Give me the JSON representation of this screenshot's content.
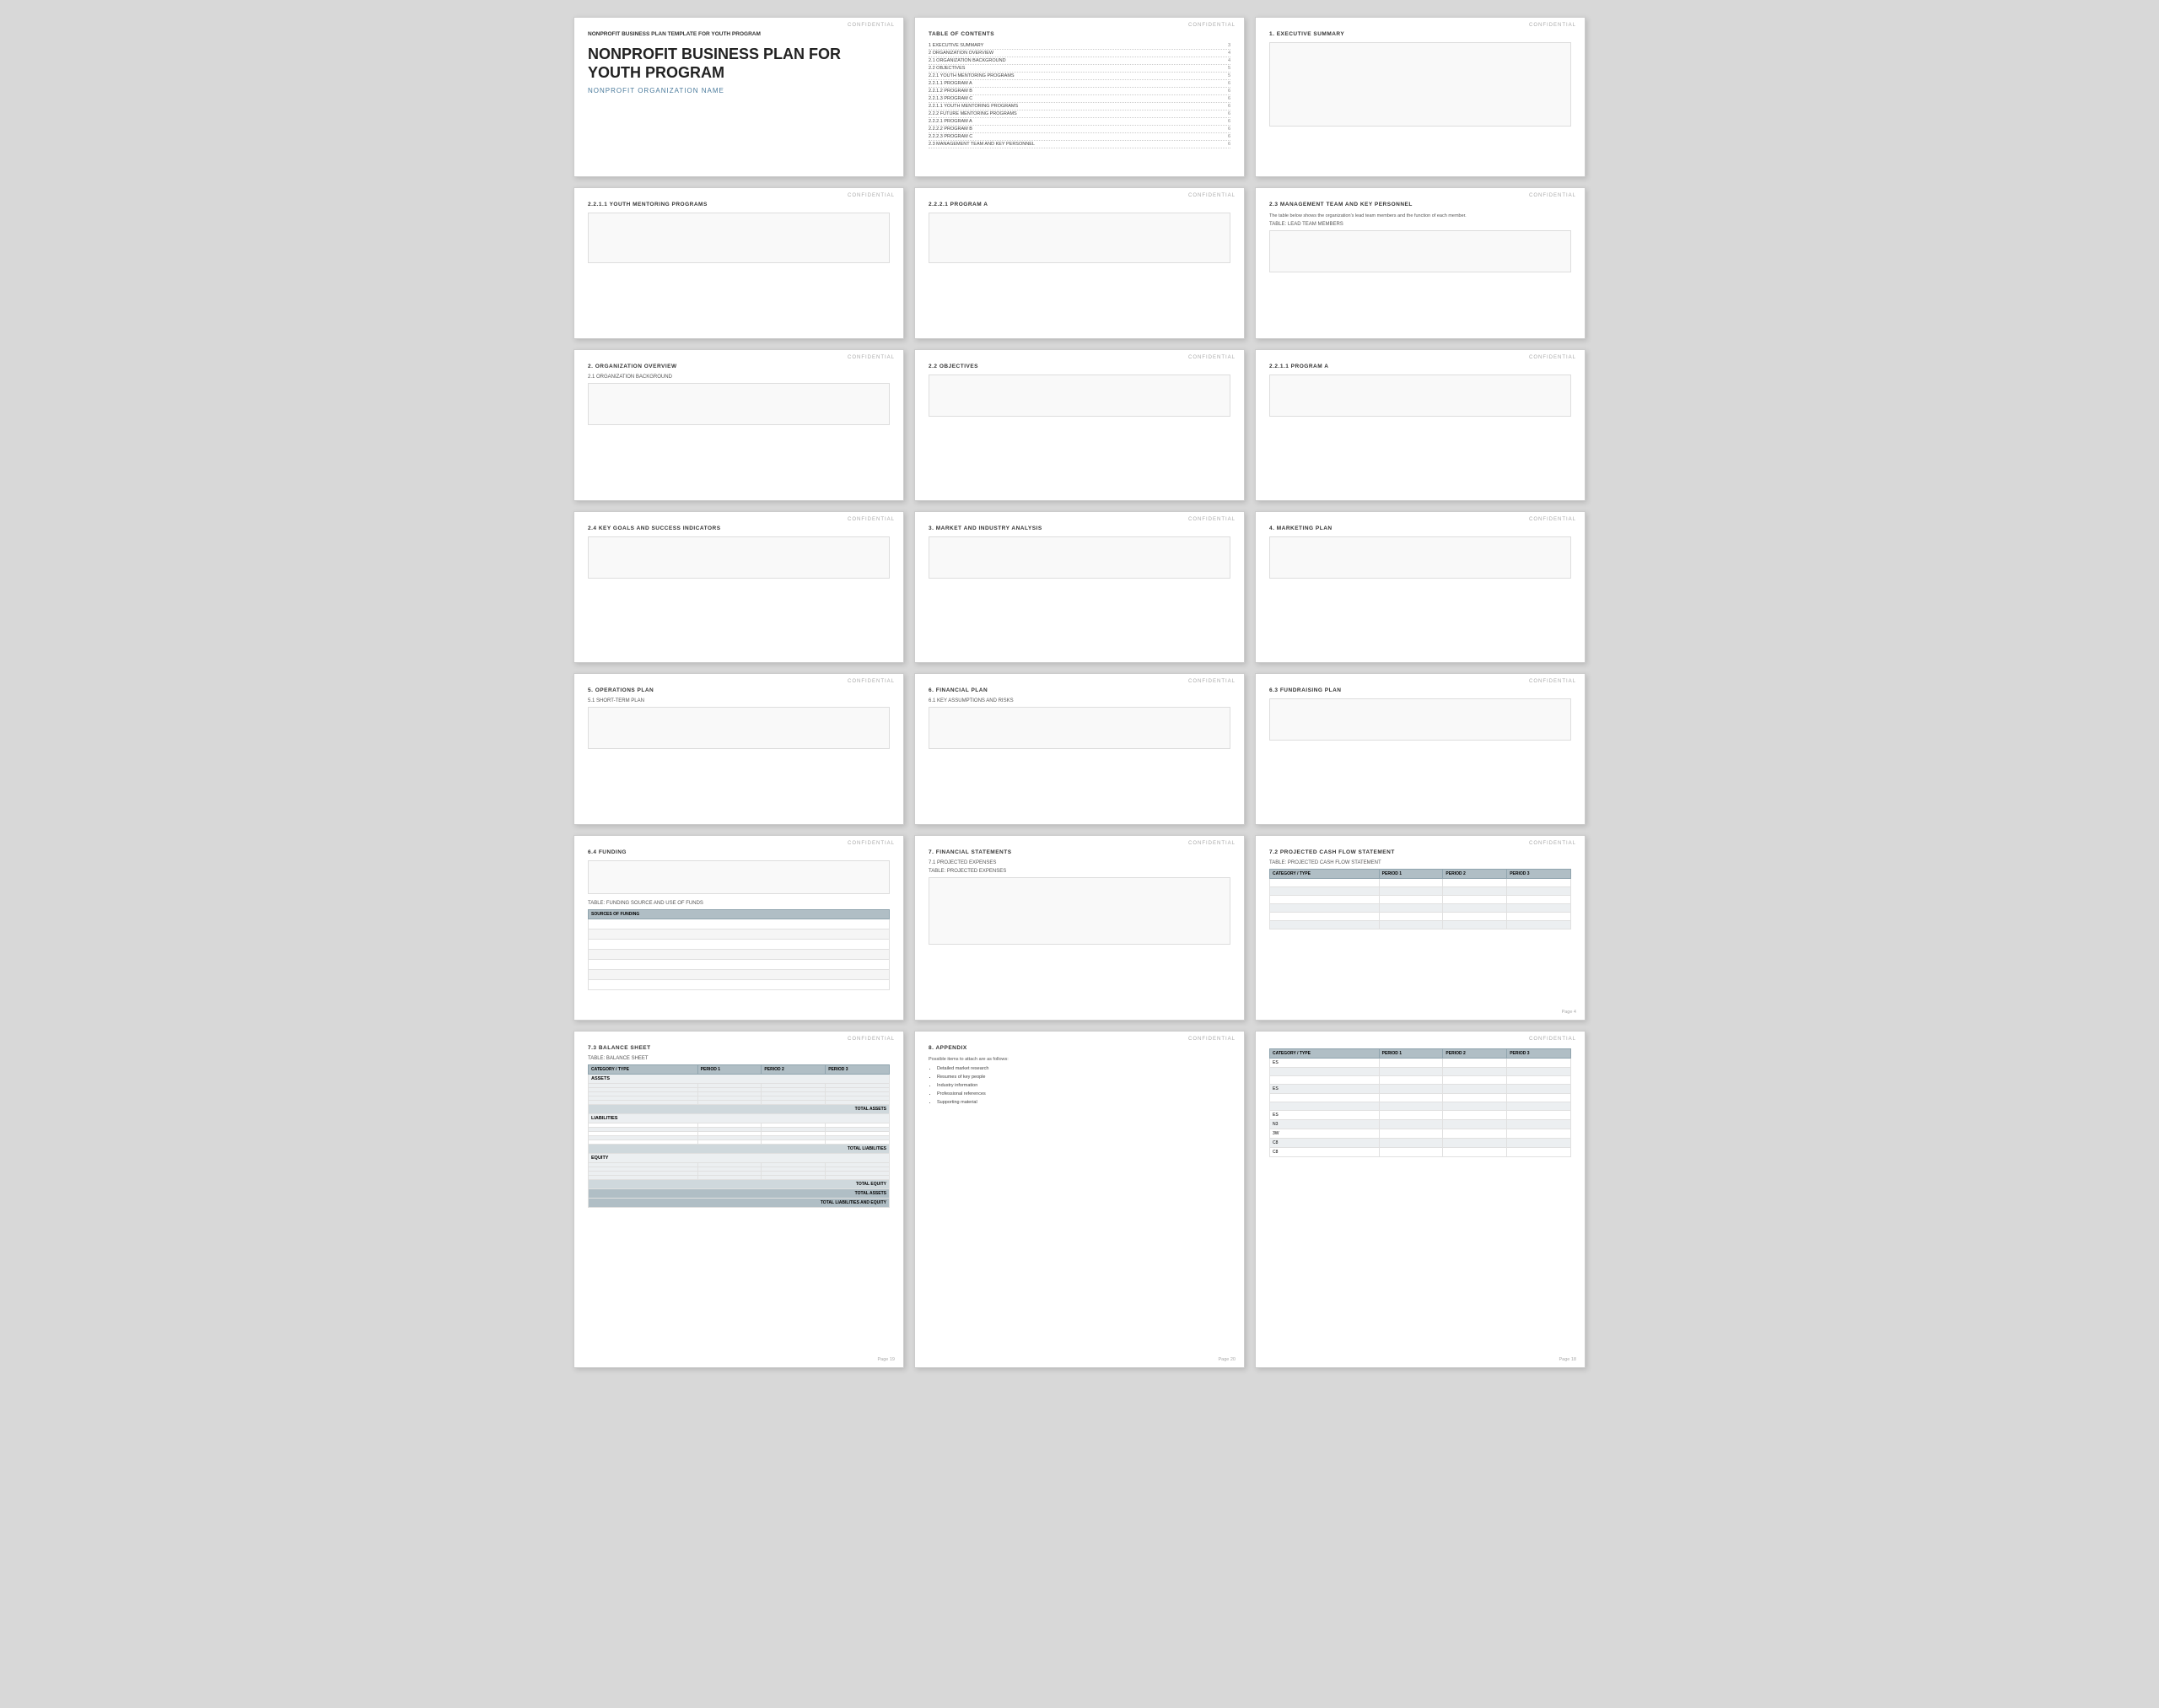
{
  "app": {
    "title": "Nonprofit Business Plan Template"
  },
  "cards": [
    {
      "id": "cover",
      "type": "cover",
      "confidential": "CONFIDENTIAL",
      "org_name": "NONPROFIT BUSINESS PLAN TEMPLATE FOR YOUTH PROGRAM",
      "big_title": "NONPROFIT BUSINESS PLAN FOR YOUTH PROGRAM",
      "tagline": "NONPROFIT ORGANIZATION NAME"
    },
    {
      "id": "toc",
      "type": "toc",
      "confidential": "CONFIDENTIAL",
      "title": "TABLE OF CONTENTS",
      "items": [
        {
          "num": "1",
          "label": "EXECUTIVE SUMMARY",
          "page": "3"
        },
        {
          "num": "2",
          "label": "ORGANIZATION OVERVIEW",
          "page": "4"
        },
        {
          "num": "2.1",
          "label": "ORGANIZATION BACKGROUND",
          "page": "4"
        },
        {
          "num": "2.2",
          "label": "OBJECTIVES",
          "page": "5"
        },
        {
          "num": "2.2.1",
          "label": "YOUTH MENTORING PROGRAMS",
          "page": "5"
        },
        {
          "num": "2.2.1.1",
          "label": "PROGRAM A",
          "page": "6"
        },
        {
          "num": "2.2.1.2",
          "label": "PROGRAM B",
          "page": "6"
        },
        {
          "num": "2.2.1.3",
          "label": "PROGRAM C",
          "page": "6"
        },
        {
          "num": "2.2.1.1",
          "label": "YOUTH MENTORING PROGRAMS",
          "page": "6"
        },
        {
          "num": "2.2.2",
          "label": "FUTURE MENTORING PROGRAMS",
          "page": "6"
        },
        {
          "num": "2.2.2.1",
          "label": "PROGRAM A",
          "page": "6"
        },
        {
          "num": "2.2.2.2",
          "label": "PROGRAM B",
          "page": "6"
        },
        {
          "num": "2.2.2.3",
          "label": "PROGRAM C",
          "page": "6"
        },
        {
          "num": "2.3",
          "label": "MANAGEMENT TEAM AND KEY PERSONNEL",
          "page": "6"
        }
      ]
    },
    {
      "id": "exec-summary",
      "type": "section",
      "confidential": "CONFIDENTIAL",
      "title": "1. EXECUTIVE SUMMARY",
      "content": ""
    },
    {
      "id": "youth-mentoring",
      "type": "section",
      "confidential": "CONFIDENTIAL",
      "title": "2.2.1.1  YOUTH MENTORING PROGRAMS",
      "content": ""
    },
    {
      "id": "program-a-1",
      "type": "section",
      "confidential": "CONFIDENTIAL",
      "title": "2.2.2.1  PROGRAM A",
      "content": ""
    },
    {
      "id": "management-team",
      "type": "management",
      "confidential": "CONFIDENTIAL",
      "title": "2.3  MANAGEMENT TEAM AND KEY PERSONNEL",
      "desc": "The table below shows the organization's lead team members and the function of each member.",
      "table_label": "TABLE:  LEAD TEAM MEMBERS"
    },
    {
      "id": "org-overview",
      "type": "section",
      "confidential": "CONFIDENTIAL",
      "title": "2. ORGANIZATION OVERVIEW",
      "subtitle": "2.1  ORGANIZATION BACKGROUND",
      "content": ""
    },
    {
      "id": "objectives",
      "type": "section",
      "confidential": "CONFIDENTIAL",
      "title": "2.2  OBJECTIVES",
      "content": ""
    },
    {
      "id": "program-a-2",
      "type": "section",
      "confidential": "CONFIDENTIAL",
      "title": "2.2.1.1  PROGRAM A",
      "content": ""
    },
    {
      "id": "key-goals",
      "type": "section",
      "confidential": "CONFIDENTIAL",
      "title": "2.4  KEY GOALS AND SUCCESS INDICATORS",
      "content": ""
    },
    {
      "id": "market-analysis",
      "type": "section",
      "confidential": "CONFIDENTIAL",
      "title": "3. MARKET AND INDUSTRY ANALYSIS",
      "content": ""
    },
    {
      "id": "marketing-plan",
      "type": "section",
      "confidential": "CONFIDENTIAL",
      "title": "4. MARKETING PLAN",
      "content": ""
    },
    {
      "id": "operations-plan",
      "type": "section",
      "confidential": "CONFIDENTIAL",
      "title": "5. OPERATIONS PLAN",
      "subtitle": "5.1  SHORT-TERM PLAN",
      "content": ""
    },
    {
      "id": "financial-plan",
      "type": "section",
      "confidential": "CONFIDENTIAL",
      "title": "6. FINANCIAL PLAN",
      "subtitle": "6.1  KEY ASSUMPTIONS AND RISKS",
      "content": ""
    },
    {
      "id": "fundraising-plan",
      "type": "section",
      "confidential": "CONFIDENTIAL",
      "title": "6.3  FUNDRAISING PLAN",
      "content": ""
    },
    {
      "id": "funding",
      "type": "funding",
      "confidential": "CONFIDENTIAL",
      "title": "6.4  FUNDING",
      "table_label": "TABLE:  FUNDING SOURCE AND USE OF FUNDS",
      "table_header": "SOURCES OF FUNDING"
    },
    {
      "id": "financial-statements",
      "type": "section",
      "confidential": "CONFIDENTIAL",
      "title": "7. FINANCIAL STATEMENTS",
      "subtitle": "7.1  PROJECTED EXPENSES",
      "table_label": "TABLE:  PROJECTED EXPENSES",
      "content": ""
    },
    {
      "id": "projected-cash",
      "type": "cashflow",
      "confidential": "CONFIDENTIAL",
      "title": "7.2  PROJECTED CASH FLOW STATEMENT",
      "table_label": "TABLE:  PROJECTED CASH FLOW STATEMENT",
      "columns": [
        "CATEGORY / TYPE",
        "PERIOD 1",
        "PERIOD 2",
        "PERIOD 3"
      ],
      "rows": [
        [
          "",
          "",
          "",
          ""
        ],
        [
          "",
          "",
          "",
          ""
        ],
        [
          "",
          "",
          "",
          ""
        ],
        [
          "",
          "",
          "",
          ""
        ],
        [
          "",
          "",
          "",
          ""
        ],
        [
          "",
          "",
          "",
          ""
        ]
      ],
      "page": "Page 4"
    },
    {
      "id": "balance-sheet",
      "type": "balance",
      "confidential": "CONFIDENTIAL",
      "title": "7.3  BALANCE SHEET",
      "table_label": "TABLE:  BALANCE SHEET",
      "columns": [
        "CATEGORY / TYPE",
        "PERIOD 1",
        "PERIOD 2",
        "PERIOD 3"
      ],
      "sections": [
        {
          "label": "ASSETS",
          "rows": [
            [
              "",
              "",
              "",
              ""
            ],
            [
              "",
              "",
              "",
              ""
            ],
            [
              "",
              "",
              "",
              ""
            ],
            [
              "",
              "",
              "",
              ""
            ],
            [
              "",
              "",
              "",
              ""
            ]
          ],
          "total": "TOTAL ASSETS"
        },
        {
          "label": "LIABILITIES",
          "rows": [
            [
              "",
              "",
              "",
              ""
            ],
            [
              "",
              "",
              "",
              ""
            ],
            [
              "",
              "",
              "",
              ""
            ],
            [
              "",
              "",
              "",
              ""
            ],
            [
              "",
              "",
              "",
              ""
            ]
          ],
          "total": "TOTAL LIABILITIES"
        },
        {
          "label": "EQUITY",
          "rows": [
            [
              "",
              "",
              "",
              ""
            ],
            [
              "",
              "",
              "",
              ""
            ],
            [
              "",
              "",
              "",
              ""
            ],
            [
              "",
              "",
              "",
              ""
            ]
          ],
          "total": "TOTAL EQUITY"
        }
      ],
      "grand_totals": [
        "TOTAL ASSETS",
        "TOTAL LIABILITIES AND EQUITY"
      ],
      "page": "Page 19"
    },
    {
      "id": "appendix",
      "type": "appendix",
      "confidential": "CONFIDENTIAL",
      "title": "8. APPENDIX",
      "intro": "Possible items to attach are as follows:",
      "bullets": [
        "Detailed market research",
        "Resumes of key people",
        "Industry information",
        "Professional references",
        "Supporting material"
      ],
      "page": "Page 20"
    },
    {
      "id": "cashflow-right",
      "type": "cashflow-right",
      "confidential": "CONFIDENTIAL",
      "columns": [
        "CATEGORY / TYPE",
        "PERIOD 1",
        "PERIOD 2",
        "PERIOD 3"
      ],
      "rows_labels": [
        "ES",
        "",
        "",
        "ES",
        "",
        "",
        "ES",
        "N3",
        "3W",
        "C8",
        "C8"
      ],
      "page": "Page 18"
    }
  ]
}
